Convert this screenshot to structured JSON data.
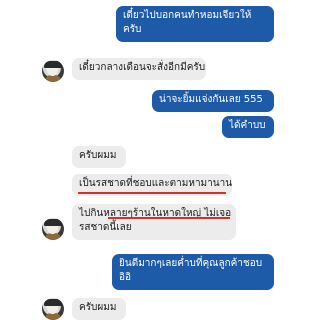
{
  "messages": [
    {
      "dir": "out",
      "line1": "เดี๋ยวไปบอกคนทำหอมเจียวให้",
      "line2": "ครับ"
    },
    {
      "dir": "in",
      "text": "เดี๋ยวกลางเดือนจะสั่งอีกมีครับ"
    },
    {
      "dir": "out",
      "text": "น่าจะยิ้มแจ่งกันเลย 555"
    },
    {
      "dir": "out",
      "text": "ได้คำบบ"
    },
    {
      "dir": "in",
      "text": "ครับผมม"
    },
    {
      "dir": "in",
      "text": "เป็นรสชาดที่ชอบและตามหามานาน"
    },
    {
      "dir": "in",
      "line1": "ไปกินหลายๆร้านในหาดใหญ่ ไม่เจอ",
      "line2": "รสชาดนี้เลย"
    },
    {
      "dir": "out",
      "line1": "ยินดีมากๆเลยค่ำบที่คุณลูกค้าชอบ",
      "line2": "อิอิ"
    },
    {
      "dir": "in",
      "text": "ครับผมม"
    }
  ],
  "colors": {
    "outgoing_bubble": "#1d5aa8",
    "incoming_bubble": "#ececec",
    "highlight_underline": "#d9302b"
  }
}
